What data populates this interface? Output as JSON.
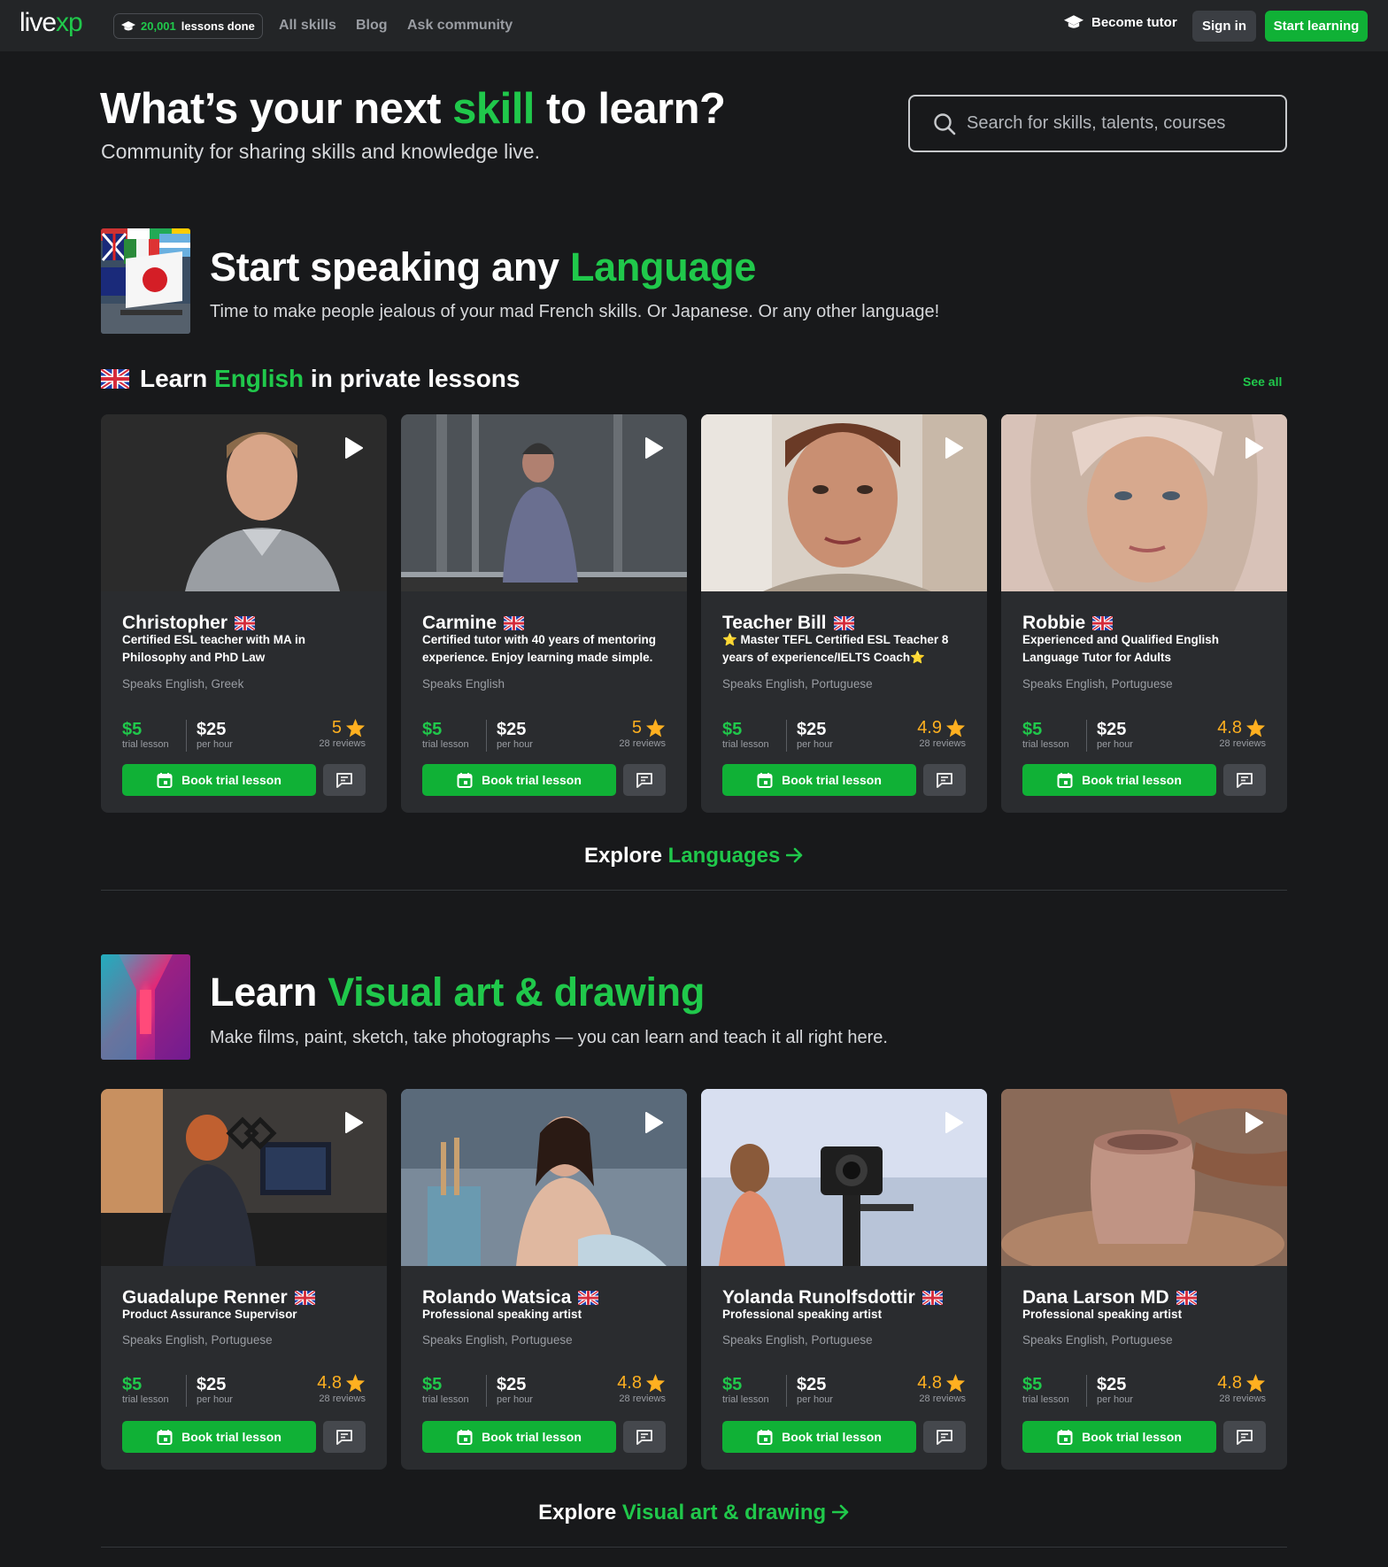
{
  "nav": {
    "logo_a": "live",
    "logo_b": "xp",
    "lessons_count": "20,001",
    "lessons_label": "lessons done",
    "links": [
      "All skills",
      "Blog",
      "Ask community"
    ],
    "become_tutor": "Become tutor",
    "sign_in": "Sign in",
    "start_learning": "Start learning"
  },
  "hero": {
    "title_a": "What’s your next ",
    "title_b": "skill",
    "title_c": " to learn?",
    "subtitle": "Community for sharing skills and knowledge live.",
    "search_placeholder": "Search for skills, talents, courses"
  },
  "languages": {
    "title_a": "Start speaking any ",
    "title_b": "Language",
    "subtitle": "Time to make people jealous of your mad French skills. Or Japanese. Or any other language!",
    "sub_a": "Learn ",
    "sub_b": "English",
    "sub_c": " in private lessons",
    "see_all": "See all",
    "explore_a": "Explore ",
    "explore_b": "Languages",
    "tutors": [
      {
        "name": "Christopher",
        "desc": "Certified ESL teacher with MA in Philosophy and PhD Law",
        "speaks": "Speaks English, Greek",
        "trial": "$5",
        "trial_label": "trial lesson",
        "hour": "$25",
        "hour_label": "per hour",
        "rating": "5",
        "reviews": "28 reviews",
        "book": "Book trial lesson"
      },
      {
        "name": "Carmine",
        "desc": "Certified tutor with 40 years of mentoring experience. Enjoy learning made simple.",
        "speaks": "Speaks English",
        "trial": "$5",
        "trial_label": "trial lesson",
        "hour": "$25",
        "hour_label": "per hour",
        "rating": "5",
        "reviews": "28 reviews",
        "book": "Book trial lesson"
      },
      {
        "name": "Teacher Bill",
        "desc": "⭐ Master TEFL Certified ESL Teacher 8 years of experience/IELTS Coach⭐",
        "speaks": "Speaks English, Portuguese",
        "trial": "$5",
        "trial_label": "trial lesson",
        "hour": "$25",
        "hour_label": "per hour",
        "rating": "4.9",
        "reviews": "28 reviews",
        "book": "Book trial lesson"
      },
      {
        "name": "Robbie",
        "desc": "Experienced and Qualified English Language Tutor for Adults",
        "speaks": "Speaks English, Portuguese",
        "trial": "$5",
        "trial_label": "trial lesson",
        "hour": "$25",
        "hour_label": "per hour",
        "rating": "4.8",
        "reviews": "28 reviews",
        "book": "Book trial lesson"
      }
    ]
  },
  "art": {
    "title_a": "Learn ",
    "title_b": "Visual art & drawing",
    "subtitle": "Make films, paint, sketch, take photographs — you can learn and teach it all right here.",
    "explore_a": "Explore ",
    "explore_b": "Visual art & drawing",
    "tutors": [
      {
        "name": "Guadalupe Renner",
        "desc": "Product Assurance Supervisor",
        "speaks": "Speaks English, Portuguese",
        "trial": "$5",
        "trial_label": "trial lesson",
        "hour": "$25",
        "hour_label": "per hour",
        "rating": "4.8",
        "reviews": "28 reviews",
        "book": "Book trial lesson"
      },
      {
        "name": "Rolando Watsica",
        "desc": "Professional speaking artist",
        "speaks": "Speaks English, Portuguese",
        "trial": "$5",
        "trial_label": "trial lesson",
        "hour": "$25",
        "hour_label": "per hour",
        "rating": "4.8",
        "reviews": "28 reviews",
        "book": "Book trial lesson"
      },
      {
        "name": "Yolanda Runolfsdottir",
        "desc": "Professional speaking artist",
        "speaks": "Speaks English, Portuguese",
        "trial": "$5",
        "trial_label": "trial lesson",
        "hour": "$25",
        "hour_label": "per hour",
        "rating": "4.8",
        "reviews": "28 reviews",
        "book": "Book trial lesson"
      },
      {
        "name": "Dana Larson MD",
        "desc": "Professional speaking artist",
        "speaks": "Speaks English, Portuguese",
        "trial": "$5",
        "trial_label": "trial lesson",
        "hour": "$25",
        "hour_label": "per hour",
        "rating": "4.8",
        "reviews": "28 reviews",
        "book": "Book trial lesson"
      }
    ]
  },
  "colors": {
    "accent": "#20c84b",
    "button": "#10b136",
    "star": "#ffb020",
    "bg": "#18191b",
    "card": "#2a2c2f"
  },
  "icons": [
    "graduation-cap-icon",
    "search-icon",
    "uk-flag-icon",
    "play-icon",
    "calendar-icon",
    "message-icon",
    "star-icon",
    "arrow-right-icon"
  ]
}
